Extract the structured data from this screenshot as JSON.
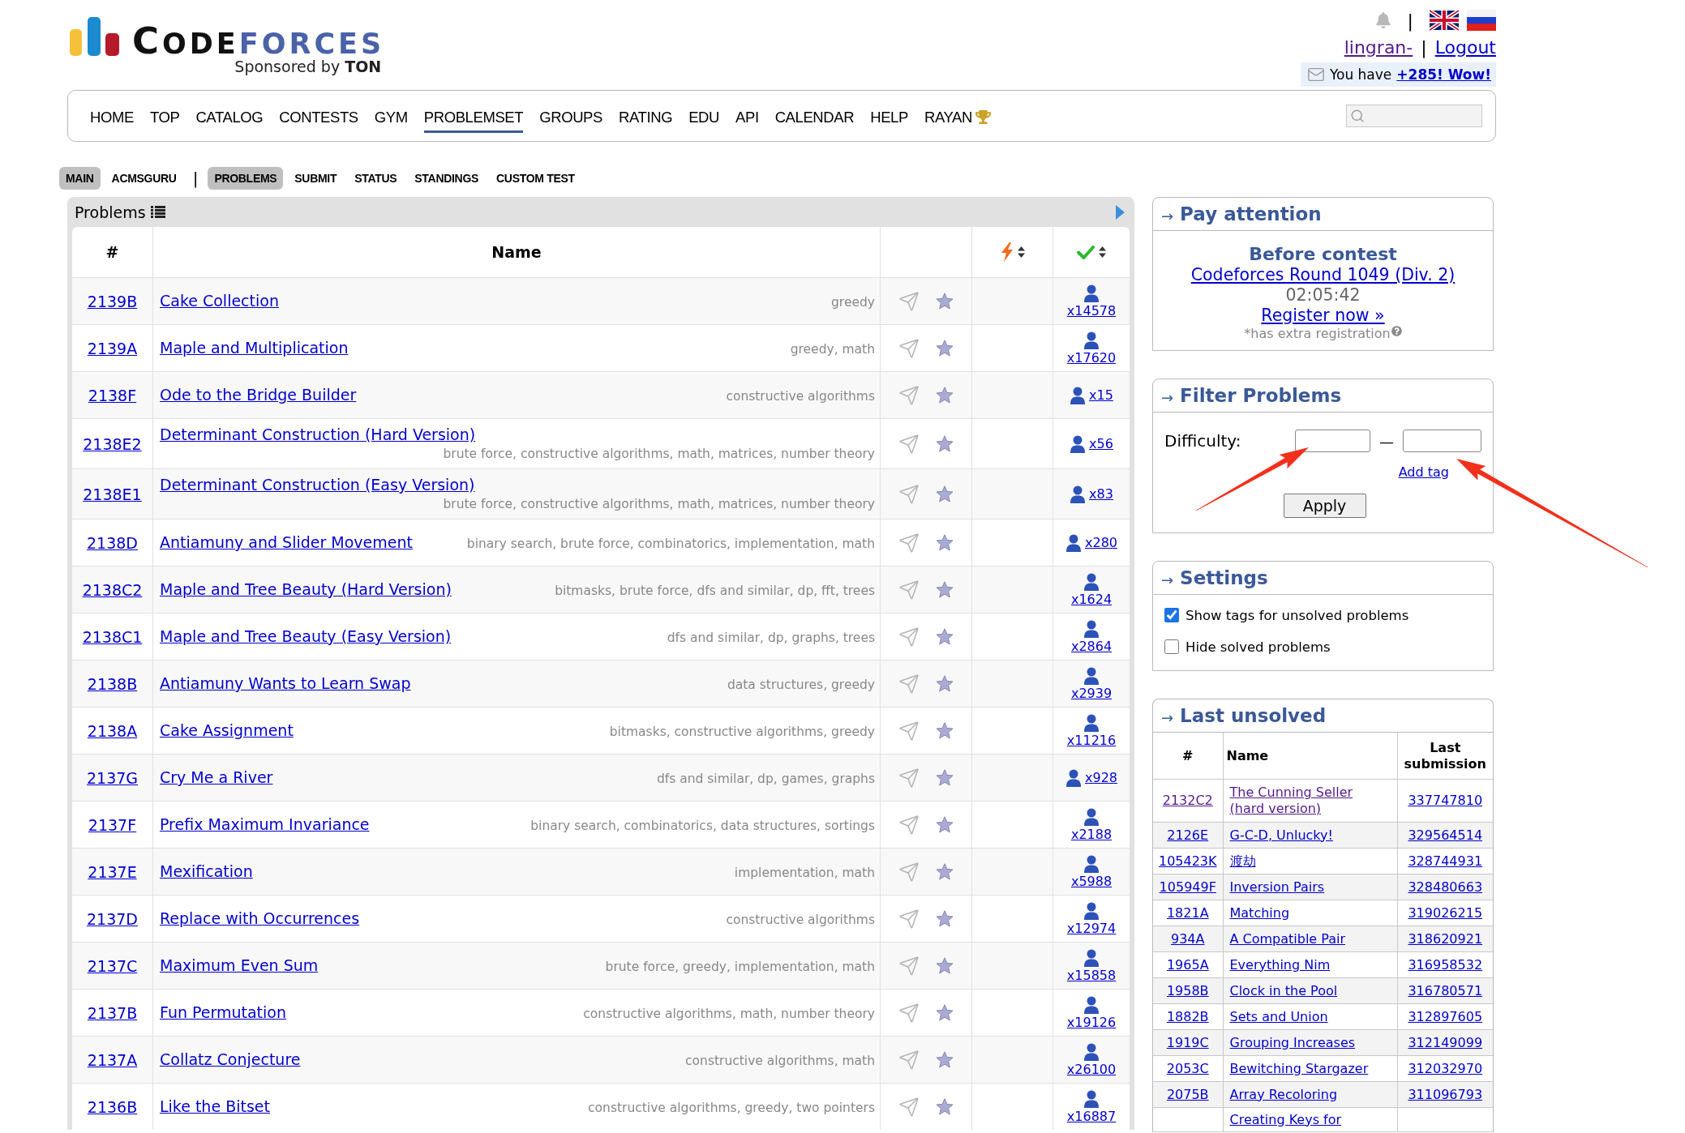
{
  "header": {
    "logo": {
      "word": "CODE",
      "word_accent": "FORCES",
      "tagline": "Sponsored by **TON**"
    },
    "tools_separator": "|",
    "user": {
      "name": "lingran-",
      "visited": true
    },
    "user_separator": "|",
    "logout": "Logout",
    "notice": {
      "text": "You have",
      "link": "+285! Wow!"
    }
  },
  "main_menu": [
    {
      "label": "HOME",
      "selected": false,
      "trophy": false
    },
    {
      "label": "TOP",
      "selected": false,
      "trophy": false
    },
    {
      "label": "CATALOG",
      "selected": false,
      "trophy": false
    },
    {
      "label": "CONTESTS",
      "selected": false,
      "trophy": false
    },
    {
      "label": "GYM",
      "selected": false,
      "trophy": false
    },
    {
      "label": "PROBLEMSET",
      "selected": true,
      "trophy": false
    },
    {
      "label": "GROUPS",
      "selected": false,
      "trophy": false
    },
    {
      "label": "RATING",
      "selected": false,
      "trophy": false
    },
    {
      "label": "EDU",
      "selected": false,
      "trophy": false
    },
    {
      "label": "API",
      "selected": false,
      "trophy": false
    },
    {
      "label": "CALENDAR",
      "selected": false,
      "trophy": false
    },
    {
      "label": "HELP",
      "selected": false,
      "trophy": false
    },
    {
      "label": "RAYAN",
      "selected": false,
      "trophy": true
    }
  ],
  "sub_menu": {
    "left": [
      {
        "label": "MAIN",
        "selected": true
      },
      {
        "label": "ACMSGURU",
        "selected": false
      }
    ],
    "separator": "|",
    "right": [
      {
        "label": "PROBLEMS",
        "selected": true
      },
      {
        "label": "SUBMIT",
        "selected": false
      },
      {
        "label": "STATUS",
        "selected": false
      },
      {
        "label": "STANDINGS",
        "selected": false
      },
      {
        "label": "CUSTOM TEST",
        "selected": false
      }
    ]
  },
  "problems": {
    "title": "Problems",
    "columns": [
      "#",
      "Name"
    ],
    "rows": [
      {
        "id": "2139B",
        "name": "Cake Collection",
        "tags": "greedy",
        "solved": "x14578"
      },
      {
        "id": "2139A",
        "name": "Maple and Multiplication",
        "tags": "greedy, math",
        "solved": "x17620"
      },
      {
        "id": "2138F",
        "name": "Ode to the Bridge Builder",
        "tags": "constructive algorithms",
        "solved": "x15"
      },
      {
        "id": "2138E2",
        "name": "Determinant Construction (Hard Version)",
        "tags": "brute force, constructive algorithms, math, matrices, number theory",
        "solved": "x56"
      },
      {
        "id": "2138E1",
        "name": "Determinant Construction (Easy Version)",
        "tags": "brute force, constructive algorithms, math, matrices, number theory",
        "solved": "x83"
      },
      {
        "id": "2138D",
        "name": "Antiamuny and Slider Movement",
        "tags": "binary search, brute force, combinatorics, implementation, math",
        "solved": "x280"
      },
      {
        "id": "2138C2",
        "name": "Maple and Tree Beauty (Hard Version)",
        "tags": "bitmasks, brute force, dfs and similar, dp, fft, trees",
        "solved": "x1624"
      },
      {
        "id": "2138C1",
        "name": "Maple and Tree Beauty (Easy Version)",
        "tags": "dfs and similar, dp, graphs, trees",
        "solved": "x2864"
      },
      {
        "id": "2138B",
        "name": "Antiamuny Wants to Learn Swap",
        "tags": "data structures, greedy",
        "solved": "x2939"
      },
      {
        "id": "2138A",
        "name": "Cake Assignment",
        "tags": "bitmasks, constructive algorithms, greedy",
        "solved": "x11216"
      },
      {
        "id": "2137G",
        "name": "Cry Me a River",
        "tags": "dfs and similar, dp, games, graphs",
        "solved": "x928"
      },
      {
        "id": "2137F",
        "name": "Prefix Maximum Invariance",
        "tags": "binary search, combinatorics, data structures, sortings",
        "solved": "x2188"
      },
      {
        "id": "2137E",
        "name": "Mexification",
        "tags": "implementation, math",
        "solved": "x5988"
      },
      {
        "id": "2137D",
        "name": "Replace with Occurrences",
        "tags": "constructive algorithms",
        "solved": "x12974"
      },
      {
        "id": "2137C",
        "name": "Maximum Even Sum",
        "tags": "brute force, greedy, implementation, math",
        "solved": "x15858"
      },
      {
        "id": "2137B",
        "name": "Fun Permutation",
        "tags": "constructive algorithms, math, number theory",
        "solved": "x19126"
      },
      {
        "id": "2137A",
        "name": "Collatz Conjecture",
        "tags": "constructive algorithms, math",
        "solved": "x26100"
      },
      {
        "id": "2136B",
        "name": "Like the Bitset",
        "tags": "constructive algorithms, greedy, two pointers",
        "solved": "x16887"
      }
    ]
  },
  "sidebar": {
    "pay_attention": {
      "arrow": "→",
      "title": "Pay attention",
      "heading": "Before contest",
      "contest": "Codeforces Round 1049 (Div. 2)",
      "countdown": "02:05:42",
      "register": "Register now »",
      "note": "*has extra registration"
    },
    "filter": {
      "arrow": "→",
      "title": "Filter Problems",
      "difficulty_label": "Difficulty:",
      "range_separator": "—",
      "add_tag": "Add tag",
      "apply": "Apply"
    },
    "settings": {
      "arrow": "→",
      "title": "Settings",
      "options": [
        {
          "label": "Show tags for unsolved problems",
          "checked": true
        },
        {
          "label": "Hide solved problems",
          "checked": false
        }
      ]
    },
    "last_unsolved": {
      "arrow": "→",
      "title": "Last unsolved",
      "columns": [
        "#",
        "Name",
        "Last submission"
      ],
      "rows": [
        {
          "code": "2132C2",
          "name": "The Cunning Seller (hard version)",
          "submission": "337747810",
          "visited": true
        },
        {
          "code": "2126E",
          "name": "G-C-D, Unlucky!",
          "submission": "329564514",
          "visited": false
        },
        {
          "code": "105423K",
          "name": "渡劫",
          "submission": "328744931",
          "visited": false
        },
        {
          "code": "105949F",
          "name": "Inversion Pairs",
          "submission": "328480663",
          "visited": false
        },
        {
          "code": "1821A",
          "name": "Matching",
          "submission": "319026215",
          "visited": false
        },
        {
          "code": "934A",
          "name": "A Compatible Pair",
          "submission": "318620921",
          "visited": false
        },
        {
          "code": "1965A",
          "name": "Everything Nim",
          "submission": "316958532",
          "visited": false
        },
        {
          "code": "1958B",
          "name": "Clock in the Pool",
          "submission": "316780571",
          "visited": false
        },
        {
          "code": "1882B",
          "name": "Sets and Union",
          "submission": "312897605",
          "visited": false
        },
        {
          "code": "1919C",
          "name": "Grouping Increases",
          "submission": "312149099",
          "visited": false
        },
        {
          "code": "2053C",
          "name": "Bewitching Stargazer",
          "submission": "312032970",
          "visited": false
        },
        {
          "code": "2075B",
          "name": "Array Recoloring",
          "submission": "311096793",
          "visited": false
        },
        {
          "name": "Creating Keys for",
          "visited": false
        }
      ]
    }
  }
}
